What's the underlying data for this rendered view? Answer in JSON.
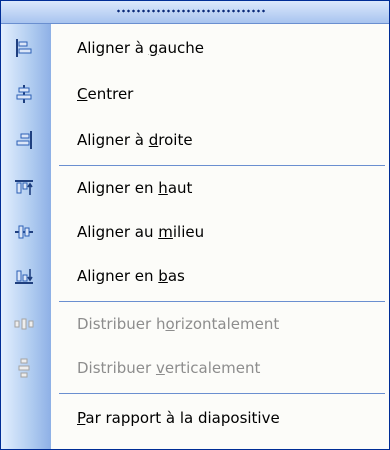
{
  "menu": {
    "items": [
      {
        "pre": "Aligner à ",
        "key": "g",
        "post": "auche",
        "icon": "align-left-icon",
        "enabled": true
      },
      {
        "pre": "",
        "key": "C",
        "post": "entrer",
        "icon": "align-center-icon",
        "enabled": true
      },
      {
        "pre": "Aligner à ",
        "key": "d",
        "post": "roite",
        "icon": "align-right-icon",
        "enabled": true
      },
      {
        "pre": "Aligner en ",
        "key": "h",
        "post": "aut",
        "icon": "align-top-icon",
        "enabled": true
      },
      {
        "pre": "Aligner au ",
        "key": "m",
        "post": "ilieu",
        "icon": "align-middle-icon",
        "enabled": true
      },
      {
        "pre": "Aligner en ",
        "key": "b",
        "post": "as",
        "icon": "align-bottom-icon",
        "enabled": true
      },
      {
        "pre": "Distribuer h",
        "key": "o",
        "post": "rizontalement",
        "icon": "distribute-horizontally-icon",
        "enabled": false
      },
      {
        "pre": "Distribuer ",
        "key": "v",
        "post": "erticalement",
        "icon": "distribute-vertically-icon",
        "enabled": false
      },
      {
        "pre": "",
        "key": "P",
        "post": "ar rapport à la diapositive",
        "icon": "",
        "enabled": true
      }
    ]
  },
  "colors": {
    "accent": "#316ac5",
    "border": "#002d96",
    "disabled": "#8d8d8d"
  }
}
